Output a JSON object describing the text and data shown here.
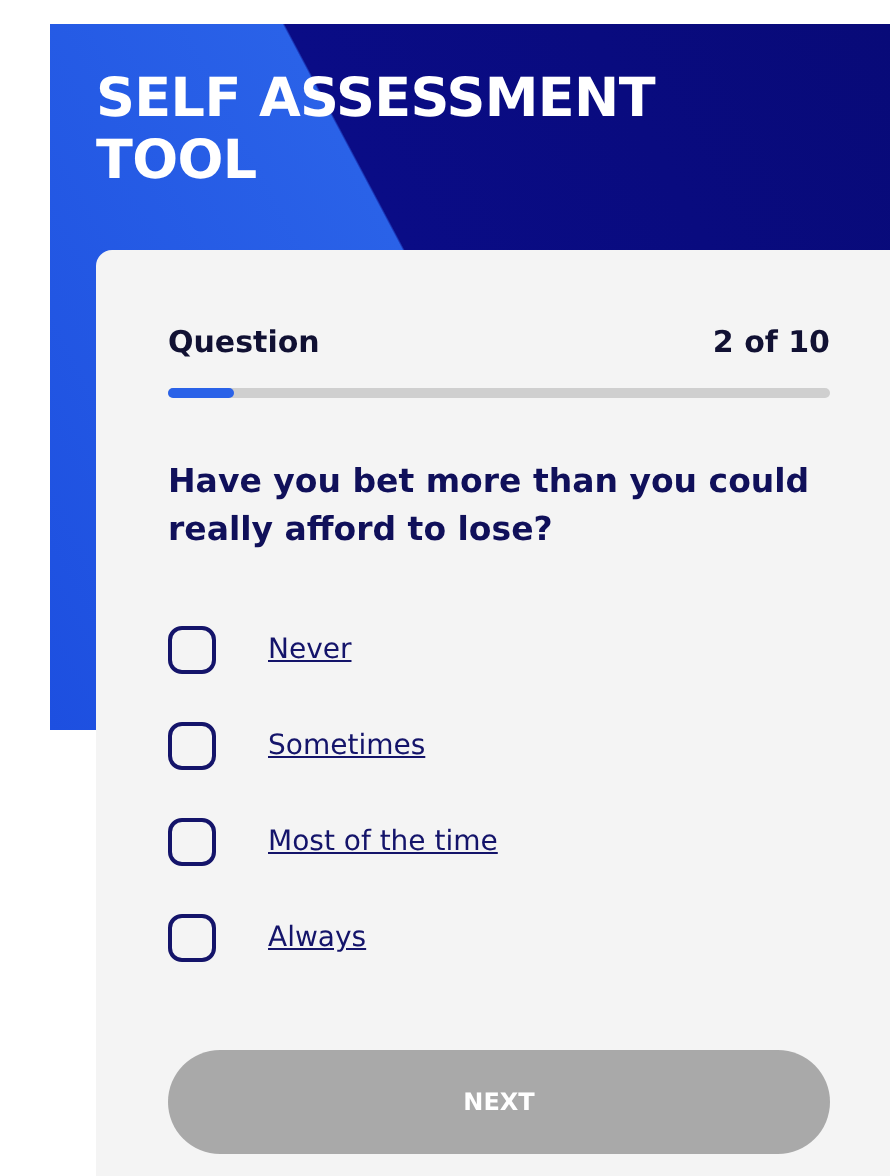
{
  "header": {
    "title": "SELF ASSESSMENT TOOL"
  },
  "progress": {
    "label": "Question",
    "count": "2 of 10",
    "level": 0.1
  },
  "question": "Have you bet more than you could really afford to lose?",
  "options": [
    {
      "label": "Never",
      "checked": false
    },
    {
      "label": "Sometimes",
      "checked": false
    },
    {
      "label": "Most of the time",
      "checked": false
    },
    {
      "label": "Always",
      "checked": false
    }
  ],
  "next_button": {
    "label": "NEXT",
    "disabled": true
  }
}
